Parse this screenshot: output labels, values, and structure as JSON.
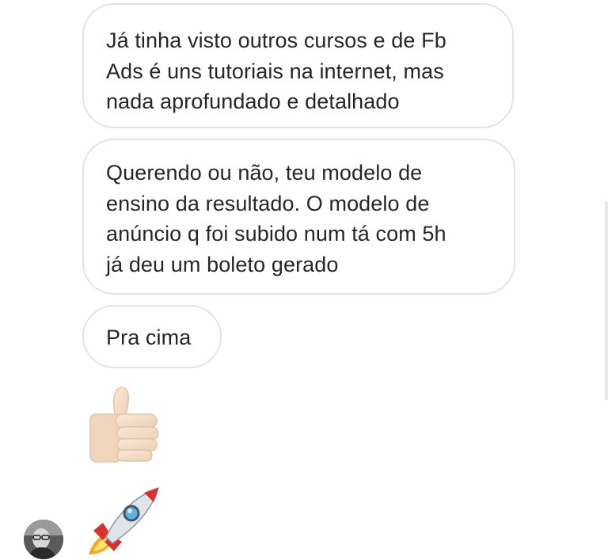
{
  "conversation": {
    "messages": [
      {
        "type": "text",
        "lines": [
          "Já tinha visto outros cursos e de Fb",
          "Ads é uns tutoriais na internet, mas",
          "nada aprofundado e detalhado"
        ]
      },
      {
        "type": "text",
        "lines": [
          "Querendo ou não, teu modelo de",
          "ensino da resultado. O modelo de",
          "anúncio q foi subido num tá com 5h",
          "já deu um boleto gerado"
        ]
      },
      {
        "type": "text",
        "lines": [
          "Pra cima"
        ]
      },
      {
        "type": "emoji",
        "icon": "thumbs-up-icon"
      },
      {
        "type": "emoji",
        "icon": "rocket-icon"
      }
    ],
    "sender": {
      "avatar_icon": "profile-photo-avatar"
    }
  },
  "colors": {
    "bubble_border": "#e3e3e3",
    "text": "#262626",
    "background": "#ffffff"
  }
}
